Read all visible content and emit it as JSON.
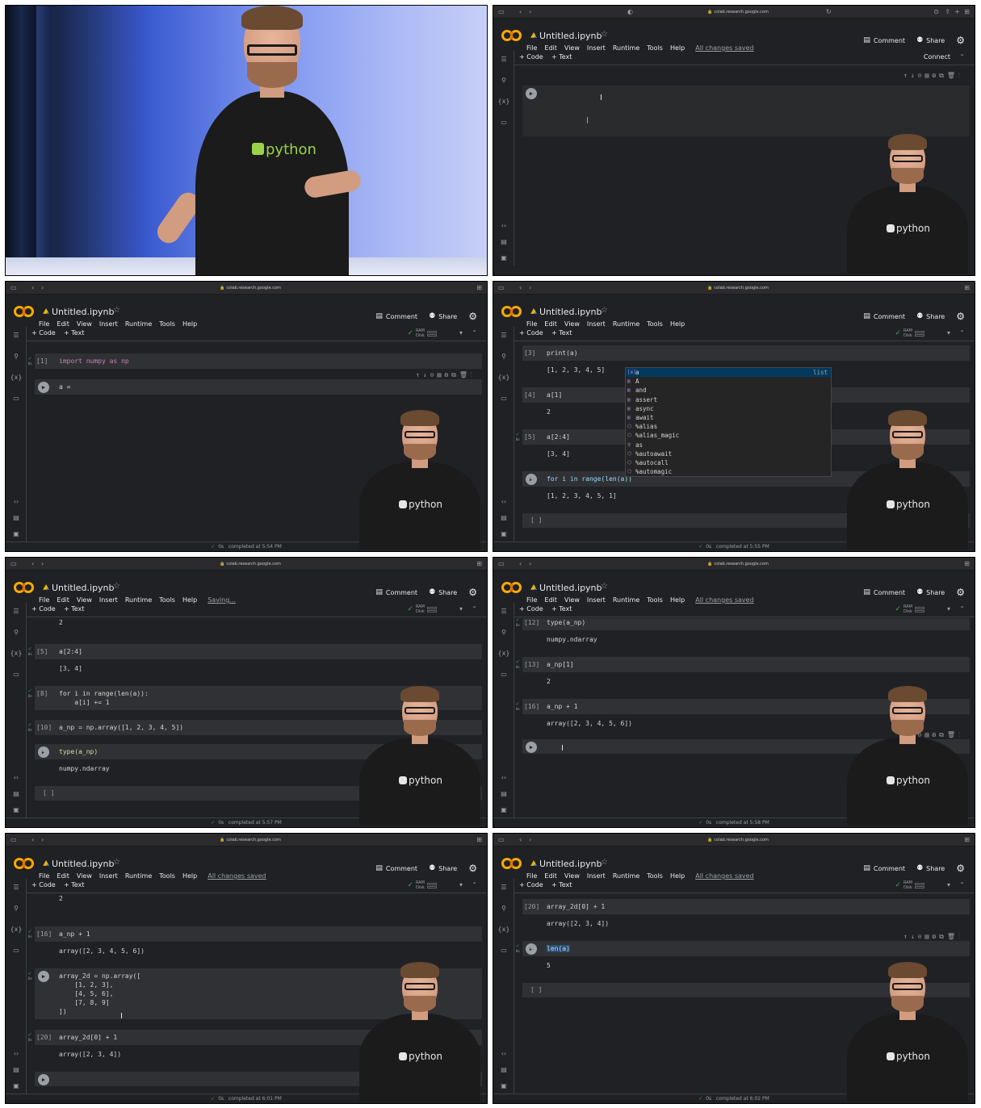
{
  "browser": {
    "url": "colab.research.google.com"
  },
  "colab": {
    "title": "Untitled.ipynb",
    "menus": [
      "File",
      "Edit",
      "View",
      "Insert",
      "Runtime",
      "Tools",
      "Help"
    ],
    "comment": "Comment",
    "share": "Share",
    "add_code": "+ Code",
    "add_text": "+ Text",
    "connect": "Connect",
    "ram": "RAM",
    "disk": "Disk"
  },
  "shirt_text": "python",
  "panels": [
    {
      "id": "p1",
      "save_status": "All changes saved"
    },
    {
      "id": "p2",
      "save_status": "",
      "cells": [
        {
          "num": "[1]",
          "code": "import numpy as np"
        },
        {
          "num": "",
          "code": "a ="
        }
      ],
      "status": {
        "time": "0s",
        "text": "completed at 5:54 PM"
      }
    },
    {
      "id": "p3",
      "save_status": "",
      "cells": [
        {
          "num": "[3]",
          "code": "print(a)",
          "out": "[1, 2, 3, 4, 5]"
        },
        {
          "num": "[4]",
          "code": "a[1]",
          "out": "2"
        },
        {
          "num": "[5]",
          "code": "a[2:4]",
          "out": "[3, 4]"
        },
        {
          "num": "",
          "code": "for i in range(len(a))",
          "out": "[1, 2, 3, 4, 5, 1]"
        },
        {
          "num": "",
          "code": "[ ]"
        }
      ],
      "autocomplete": {
        "items": [
          "a",
          "A",
          "and",
          "assert",
          "async",
          "await",
          "%alias",
          "%alias_magic",
          "as",
          "%autoawait",
          "%autocall",
          "%automagic"
        ],
        "selected_type": "list"
      },
      "status": {
        "time": "0s",
        "text": "completed at 5:55 PM"
      }
    },
    {
      "id": "p4",
      "save_status": "Saving...",
      "cells": [
        {
          "num": "",
          "code": "",
          "out": "2"
        },
        {
          "num": "[5]",
          "code": "a[2:4]",
          "out": "[3, 4]"
        },
        {
          "num": "[8]",
          "code": "for i in range(len(a)):\n    a[i] += 1"
        },
        {
          "num": "[10]",
          "code": "a_np = np.array([1, 2, 3, 4, 5])"
        },
        {
          "num": "",
          "code": "type(a_np)",
          "out": "numpy.ndarray"
        },
        {
          "num": "",
          "code": "[ ]"
        }
      ],
      "status": {
        "time": "0s",
        "text": "completed at 5:57 PM"
      }
    },
    {
      "id": "p5",
      "save_status": "All changes saved",
      "cells": [
        {
          "num": "[12]",
          "code": "type(a_np)",
          "out": "numpy.ndarray"
        },
        {
          "num": "[13]",
          "code": "a_np[1]",
          "out": "2"
        },
        {
          "num": "[16]",
          "code": "a_np + 1",
          "out": "array([2, 3, 4, 5, 6])"
        },
        {
          "num": "",
          "code": ""
        }
      ],
      "status": {
        "time": "0s",
        "text": "completed at 5:58 PM"
      }
    },
    {
      "id": "p6",
      "save_status": "All changes saved",
      "cells": [
        {
          "num": "",
          "code": "",
          "out": "2"
        },
        {
          "num": "[16]",
          "code": "a_np + 1",
          "out": "array([2, 3, 4, 5, 6])"
        },
        {
          "num": "",
          "code": "array_2d = np.array([\n    [1, 2, 3],\n    [4, 5, 6],\n    [7, 8, 9]\n])"
        },
        {
          "num": "[20]",
          "code": "array_2d[0] + 1",
          "out": "array([2, 3, 4])"
        },
        {
          "num": "",
          "code": ""
        }
      ],
      "status": {
        "time": "0s",
        "text": "completed at 6:01 PM"
      }
    },
    {
      "id": "p7",
      "save_status": "All changes saved",
      "cells": [
        {
          "num": "[20]",
          "code": "array_2d[0] + 1",
          "out": "array([2, 3, 4])"
        },
        {
          "num": "",
          "code": "len(a)",
          "out": "5"
        },
        {
          "num": "",
          "code": "[ ]"
        }
      ],
      "status": {
        "time": "0s",
        "text": "completed at 6:02 PM"
      }
    }
  ]
}
